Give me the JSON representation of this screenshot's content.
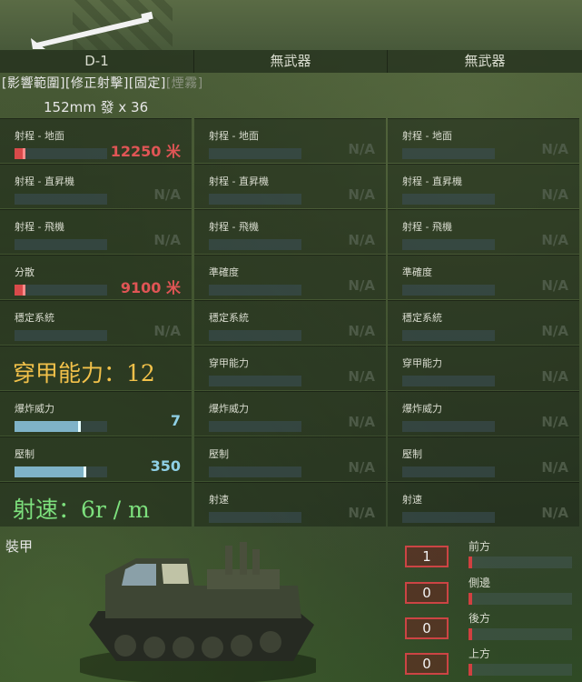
{
  "weapons": [
    {
      "name": "D-1",
      "tags": [
        "[影響範圍]",
        "[修正射擊]",
        "[固定]",
        "[煙霧]"
      ],
      "ammo": "152mm 發 x 36",
      "stats": [
        {
          "label": "射程 - 地面",
          "value": "12250 米",
          "fill": 0.12
        },
        {
          "label": "射程 - 直昇機",
          "value": "N/A"
        },
        {
          "label": "射程 - 飛機",
          "value": "N/A"
        },
        {
          "label": "分散",
          "value": "9100 米",
          "fill": 0.12
        },
        {
          "label": "穩定系統",
          "value": "N/A"
        },
        {
          "label": "穿甲能力：12",
          "value": "",
          "big": true
        },
        {
          "label": "爆炸威力",
          "value": "7",
          "fill": 0.72
        },
        {
          "label": "壓制",
          "value": "350",
          "fill": 0.77
        },
        {
          "label": "射速：6r / m",
          "value": "",
          "big": true
        }
      ]
    },
    {
      "name": "無武器",
      "stats": [
        {
          "label": "射程 - 地面",
          "value": "N/A"
        },
        {
          "label": "射程 - 直昇機",
          "value": "N/A"
        },
        {
          "label": "射程 - 飛機",
          "value": "N/A"
        },
        {
          "label": "準確度",
          "value": "N/A"
        },
        {
          "label": "穩定系統",
          "value": "N/A"
        },
        {
          "label": "穿甲能力",
          "value": "N/A"
        },
        {
          "label": "爆炸威力",
          "value": "N/A"
        },
        {
          "label": "壓制",
          "value": "N/A"
        },
        {
          "label": "射速",
          "value": "N/A"
        }
      ]
    },
    {
      "name": "無武器",
      "stats": [
        {
          "label": "射程 - 地面",
          "value": "N/A"
        },
        {
          "label": "射程 - 直昇機",
          "value": "N/A"
        },
        {
          "label": "射程 - 飛機",
          "value": "N/A"
        },
        {
          "label": "準確度",
          "value": "N/A"
        },
        {
          "label": "穩定系統",
          "value": "N/A"
        },
        {
          "label": "穿甲能力",
          "value": "N/A"
        },
        {
          "label": "爆炸威力",
          "value": "N/A"
        },
        {
          "label": "壓制",
          "value": "N/A"
        },
        {
          "label": "射速",
          "value": "N/A"
        }
      ]
    }
  ],
  "armor": {
    "title": "裝甲",
    "sides": [
      {
        "label": "前方",
        "value": "1"
      },
      {
        "label": "側邊",
        "value": "0"
      },
      {
        "label": "後方",
        "value": "0"
      },
      {
        "label": "上方",
        "value": "0"
      }
    ]
  },
  "colors": {
    "range_bar": "#d84a4a",
    "range_value": "#e05555",
    "blue_bar": "#7fb3c8",
    "blue_value": "#8fd0e6",
    "pen_text": "#f2c14a",
    "rof_text": "#7de07d"
  }
}
